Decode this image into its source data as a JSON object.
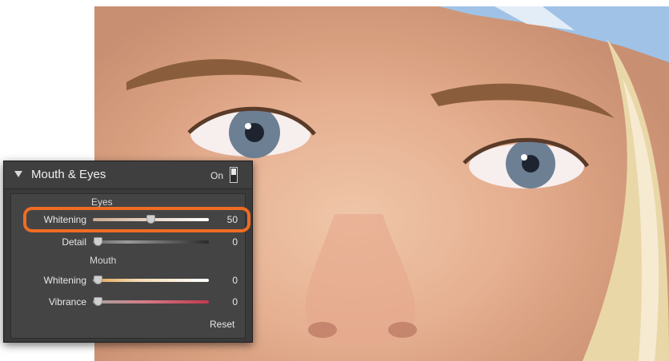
{
  "panel": {
    "title": "Mouth & Eyes",
    "on_label": "On",
    "toggle_state": "on",
    "reset_label": "Reset",
    "sections": {
      "eyes": "Eyes",
      "mouth": "Mouth"
    },
    "sliders": [
      {
        "id": "eyes-whitening",
        "label": "Whitening",
        "value": "50",
        "level": 0.5
      },
      {
        "id": "eyes-detail",
        "label": "Detail",
        "value": "0",
        "level": 0
      },
      {
        "id": "mouth-whitening",
        "label": "Whitening",
        "value": "0",
        "level": 0
      },
      {
        "id": "mouth-vibrance",
        "label": "Vibrance",
        "value": "0",
        "level": 0
      }
    ]
  },
  "colors": {
    "highlight": "#ef6c23",
    "panel_bg": "#3a3a3a",
    "body_bg": "#444444"
  }
}
